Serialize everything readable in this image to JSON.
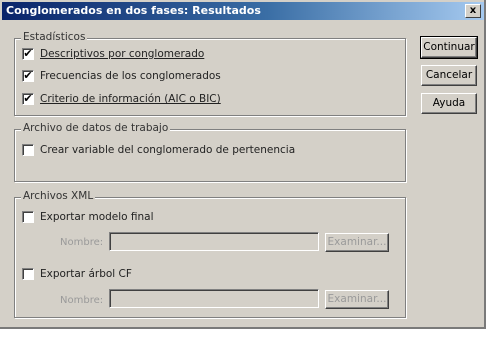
{
  "dialog": {
    "title": "Conglomerados en dos fases: Resultados",
    "close_label": "x"
  },
  "estadisticos": {
    "label": "Estadísticos",
    "items": [
      {
        "label": "Descriptivos por conglomerado",
        "checked": true,
        "mark": "✔"
      },
      {
        "label": "Frecuencias de los conglomerados",
        "checked": true,
        "mark": "✔"
      },
      {
        "label": "Criterio de información (AIC o BIC)",
        "checked": true,
        "mark": "✔"
      }
    ]
  },
  "archivo_datos": {
    "label": "Archivo de datos de trabajo",
    "item": {
      "label": "Crear variable del conglomerado de pertenencia",
      "checked": false,
      "mark": ""
    }
  },
  "archivos_xml": {
    "label": "Archivos XML",
    "export_model": {
      "label": "Exportar modelo final",
      "checked": false,
      "mark": ""
    },
    "export_model_name_label": "Nombre:",
    "export_model_name_value": "",
    "export_model_browse": "Examinar...",
    "export_tree": {
      "label": "Exportar árbol CF",
      "checked": false,
      "mark": ""
    },
    "export_tree_name_label": "Nombre:",
    "export_tree_name_value": "",
    "export_tree_browse": "Examinar..."
  },
  "buttons": {
    "continue": "Continuar",
    "cancel": "Cancelar",
    "help": "Ayuda"
  }
}
